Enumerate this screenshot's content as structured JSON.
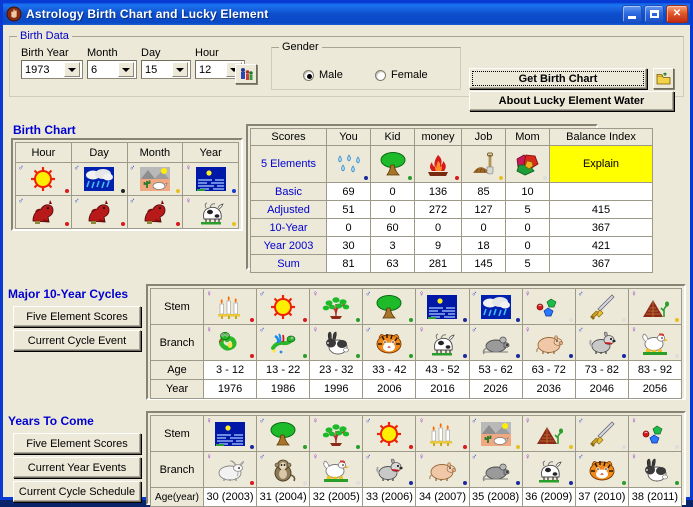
{
  "window": {
    "title": "Astrology Birth Chart and Lucky Element",
    "icon": "hand-icon",
    "minimize_label": "Minimize",
    "maximize_label": "Maximize",
    "close_label": "Close"
  },
  "birth_data": {
    "legend": "Birth Data",
    "fields": [
      {
        "label": "Birth Year",
        "value": "1973",
        "name": "birth-year-select"
      },
      {
        "label": "Month",
        "value": "6",
        "name": "month-select"
      },
      {
        "label": "Day",
        "value": "15",
        "name": "day-select"
      },
      {
        "label": "Hour",
        "value": "12",
        "name": "hour-select"
      }
    ],
    "people_button": "people-icon",
    "gender": {
      "legend": "Gender",
      "options": [
        {
          "label": "Male",
          "selected": true
        },
        {
          "label": "Female",
          "selected": false
        }
      ]
    },
    "get_birth_chart": "Get Birth Chart",
    "about_lucky": "About Lucky Element Water",
    "folder_button": "open-folder-icon"
  },
  "birth_chart": {
    "heading": "Birth Chart",
    "columns": [
      "Hour",
      "Day",
      "Month",
      "Year"
    ],
    "stem_icons": [
      "sun",
      "rain-cloud",
      "desert-mountain",
      "sea-night"
    ],
    "branch_icons": [
      "horse",
      "horse",
      "horse",
      "cow"
    ]
  },
  "scores": {
    "columns": [
      "Scores",
      "You",
      "Kid",
      "money",
      "Job",
      "Mom",
      "Balance Index"
    ],
    "element_row_label": "5 Elements",
    "element_icons": [
      "water-drops",
      "tree",
      "fire",
      "earth-shovel",
      "metal-gems"
    ],
    "explain_label": "Explain",
    "explain_color": "#ffff00",
    "rows": [
      {
        "label": "Basic",
        "values": [
          "69",
          "0",
          "136",
          "85",
          "10"
        ],
        "balance": ""
      },
      {
        "label": "Adjusted",
        "values": [
          "51",
          "0",
          "272",
          "127",
          "5"
        ],
        "balance": "415"
      },
      {
        "label": "10-Year",
        "values": [
          "0",
          "60",
          "0",
          "0",
          "0"
        ],
        "balance": "367"
      },
      {
        "label": "Year 2003",
        "values": [
          "30",
          "3",
          "9",
          "18",
          "0"
        ],
        "balance": "421"
      },
      {
        "label": "Sum",
        "values": [
          "81",
          "63",
          "281",
          "145",
          "5"
        ],
        "balance": "367"
      }
    ]
  },
  "major_cycles": {
    "heading": "Major 10-Year Cycles",
    "buttons": [
      "Five Element Scores",
      "Current Cycle Event"
    ],
    "row_labels": [
      "Stem",
      "Branch",
      "Age",
      "Year"
    ],
    "stem_icons": [
      "candles",
      "sun",
      "plant",
      "tree",
      "sea-night",
      "rain-cloud",
      "metal-gems",
      "sword",
      "earth-mountain"
    ],
    "branch_icons": [
      "snake",
      "dragon",
      "rabbit",
      "tiger",
      "cow",
      "rat",
      "pig",
      "dog",
      "rooster"
    ],
    "ages": [
      "3 - 12",
      "13 - 22",
      "23 - 32",
      "33 - 42",
      "43 - 52",
      "53 - 62",
      "63 - 72",
      "73 - 82",
      "83 - 92"
    ],
    "years": [
      "1976",
      "1986",
      "1996",
      "2006",
      "2016",
      "2026",
      "2036",
      "2046",
      "2056"
    ]
  },
  "years_to_come": {
    "heading": "Years To Come",
    "buttons": [
      "Five Element Scores",
      "Current Year Events",
      "Current Cycle Schedule"
    ],
    "row_labels": [
      "Stem",
      "Branch",
      "Age(year)"
    ],
    "stem_icons": [
      "sea-night",
      "tree",
      "plant",
      "sun",
      "candles",
      "desert-mountain",
      "earth-mountain",
      "sword",
      "metal-gems"
    ],
    "branch_icons": [
      "goat",
      "monkey",
      "rooster",
      "dog",
      "pig",
      "rat",
      "cow",
      "tiger",
      "rabbit"
    ],
    "ages": [
      "30 (2003)",
      "31 (2004)",
      "32 (2005)",
      "33 (2006)",
      "34 (2007)",
      "35 (2008)",
      "36 (2009)",
      "37 (2010)",
      "38 (2011)"
    ]
  }
}
